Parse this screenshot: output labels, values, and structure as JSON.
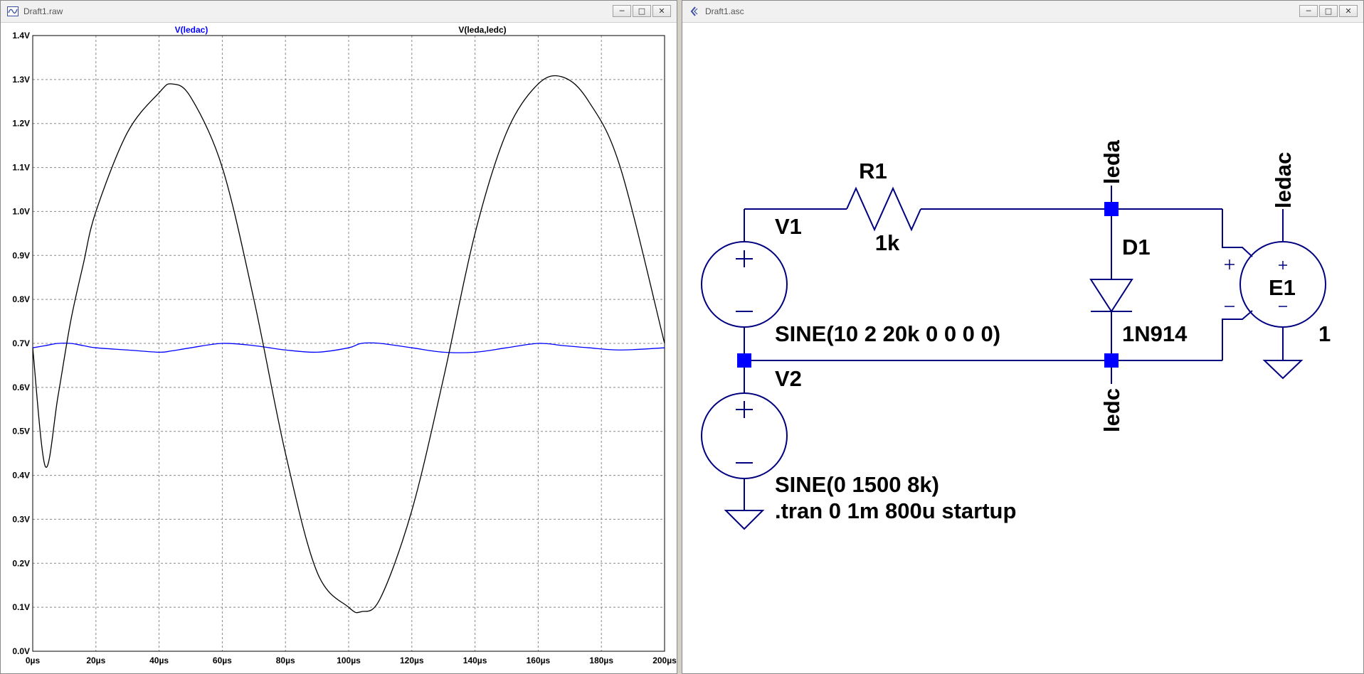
{
  "plot_window": {
    "title": "Draft1.raw",
    "buttons": {
      "minimize": "─",
      "maximize": "□",
      "close": "✕"
    }
  },
  "schematic_window": {
    "title": "Draft1.asc",
    "buttons": {
      "minimize": "─",
      "maximize": "□",
      "close": "✕"
    }
  },
  "chart_data": {
    "type": "line",
    "x": [
      0,
      4,
      8,
      12,
      16,
      20,
      30,
      40,
      44,
      50,
      60,
      70,
      80,
      90,
      100,
      104,
      110,
      120,
      130,
      140,
      150,
      160,
      168,
      176,
      186,
      200
    ],
    "series": [
      {
        "name": "V(ledac)",
        "color": "#0000ff",
        "values": [
          0.69,
          0.695,
          0.7,
          0.7,
          0.695,
          0.69,
          0.685,
          0.68,
          0.683,
          0.69,
          0.7,
          0.695,
          0.685,
          0.68,
          0.69,
          0.7,
          0.7,
          0.69,
          0.68,
          0.68,
          0.69,
          0.7,
          0.695,
          0.69,
          0.685,
          0.69
        ]
      },
      {
        "name": "V(leda,ledc)",
        "color": "#000000",
        "values": [
          0.69,
          0.42,
          0.58,
          0.75,
          0.88,
          1.0,
          1.18,
          1.27,
          1.29,
          1.26,
          1.1,
          0.8,
          0.45,
          0.18,
          0.1,
          0.09,
          0.12,
          0.32,
          0.62,
          0.95,
          1.18,
          1.29,
          1.305,
          1.25,
          1.1,
          0.7
        ]
      }
    ],
    "xlim": [
      0,
      200
    ],
    "ylim": [
      0,
      1.4
    ],
    "x_ticks": [
      "0µs",
      "20µs",
      "40µs",
      "60µs",
      "80µs",
      "100µs",
      "120µs",
      "140µs",
      "160µs",
      "180µs",
      "200µs"
    ],
    "y_ticks": [
      "0.0V",
      "0.1V",
      "0.2V",
      "0.3V",
      "0.4V",
      "0.5V",
      "0.6V",
      "0.7V",
      "0.8V",
      "0.9V",
      "1.0V",
      "1.1V",
      "1.2V",
      "1.3V",
      "1.4V"
    ],
    "grid": true,
    "legend_placement": "top"
  },
  "schematic": {
    "wire_color": "#000080",
    "junction_color": "#0000ff",
    "labels": {
      "r1_name": "R1",
      "r1_value": "1k",
      "v1_name": "V1",
      "v1_value": "SINE(10 2 20k 0 0 0 0)",
      "v2_name": "V2",
      "v2_value": "SINE(0 1500 8k)",
      "d1_name": "D1",
      "d1_value": "1N914",
      "e1_name": "E1",
      "e1_value": "1",
      "net_leda": "leda",
      "net_ledc": "ledc",
      "net_ledac": "ledac",
      "directive": ".tran 0 1m 800u startup",
      "plus": "+",
      "minus": "−"
    }
  }
}
